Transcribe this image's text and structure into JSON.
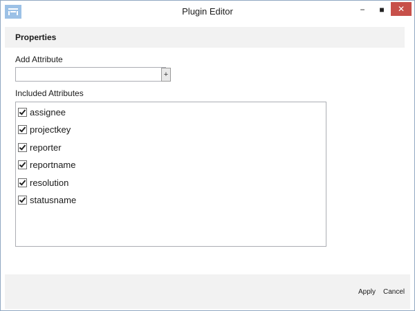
{
  "window": {
    "title": "Plugin Editor",
    "minimize_glyph": "−",
    "maximize_glyph": "■",
    "close_glyph": "✕",
    "close_color": "#c7504a"
  },
  "properties": {
    "heading": "Properties"
  },
  "add_attribute": {
    "label": "Add Attribute",
    "value": "",
    "add_button_label": "+"
  },
  "included_attributes": {
    "label": "Included Attributes",
    "items": [
      {
        "label": "assignee",
        "checked": true
      },
      {
        "label": "projectkey",
        "checked": true
      },
      {
        "label": "reporter",
        "checked": true
      },
      {
        "label": "reportname",
        "checked": true
      },
      {
        "label": "resolution",
        "checked": true
      },
      {
        "label": "statusname",
        "checked": true
      }
    ]
  },
  "footer": {
    "apply_label": "Apply",
    "cancel_label": "Cancel"
  }
}
